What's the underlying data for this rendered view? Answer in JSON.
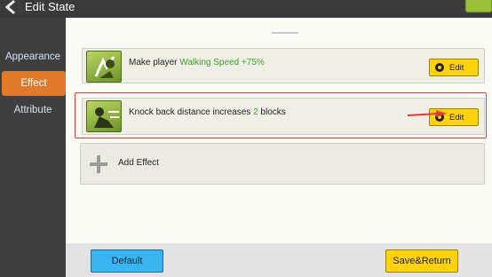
{
  "header": {
    "title": "Edit State"
  },
  "sidebar": {
    "tabs": [
      {
        "label": "Appearance",
        "active": false
      },
      {
        "label": "Effect",
        "active": true
      },
      {
        "label": "Attribute",
        "active": false
      }
    ]
  },
  "main": {
    "effects": [
      {
        "prefix": "Make player ",
        "highlight": "Walking Speed +75%",
        "suffix": "",
        "button": "Edit"
      },
      {
        "prefix": "Knock back distance increases ",
        "highlight": "2",
        "suffix": " blocks",
        "button": "Edit"
      }
    ],
    "add_effect_label": "Add Effect"
  },
  "footer": {
    "default_label": "Default",
    "save_label": "Save&Return"
  },
  "colors": {
    "accent_orange": "#e07a2a",
    "highlight_green": "#3fa02a",
    "button_yellow": "#ffd20c",
    "button_blue": "#39b6f0",
    "annotation_red": "#e23b3b"
  }
}
